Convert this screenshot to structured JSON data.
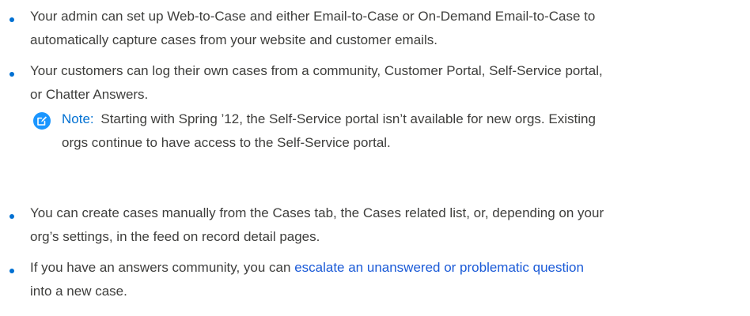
{
  "bullets": [
    {
      "line1": "Your admin can set up Web-to-Case and either Email-to-Case or On-Demand Email-to-Case to",
      "line2": "automatically capture cases from your website and customer emails."
    },
    {
      "line1": "Your customers can log their own cases from a community, Customer Portal, Self-Service portal,",
      "line2": "or Chatter Answers."
    },
    {
      "line1": "You can create cases manually from the Cases tab, the Cases related list, or, depending on your",
      "line2": "org’s settings, in the feed on record detail pages."
    },
    {
      "line1_prefix": "If you have an answers community, you can ",
      "line1_link": "escalate an unanswered or problematic question",
      "line2": "into a new case."
    }
  ],
  "note": {
    "label": "Note:",
    "line1": "Starting with Spring ’12, the Self-Service portal isn’t available for new orgs. Existing",
    "line2": "orgs continue to have access to the Self-Service portal.",
    "icon": "note-edit-icon",
    "icon_color": "#1b96ff"
  },
  "colors": {
    "bullet": "#0070d2",
    "link": "#1a5ad7",
    "note_label": "#0070d2",
    "text": "#3e3e3c"
  }
}
